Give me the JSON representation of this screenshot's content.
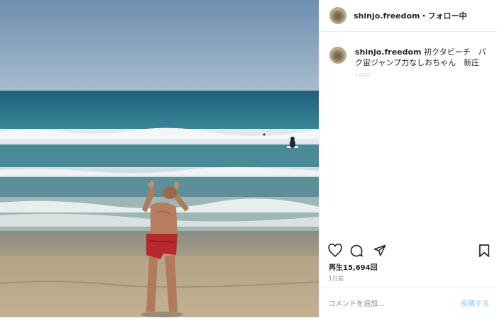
{
  "header": {
    "username": "shinjo.freedom",
    "separator": "・",
    "follow_label": "フォロー中"
  },
  "caption": {
    "username": "shinjo.freedom",
    "text": "初クタビーチ　バク宙ジャンプ力なしおちゃん　新庄"
  },
  "actions": {
    "like_icon": "heart-icon",
    "comment_icon": "comment-icon",
    "share_icon": "share-icon",
    "save_icon": "bookmark-icon"
  },
  "stats": {
    "views_label": "再生",
    "views_count": "15,694回"
  },
  "post_age": "1日前",
  "comment_box": {
    "placeholder": "コメントを追加...",
    "post_label": "投稿する"
  },
  "colors": {
    "post_button_disabled": "#b3dbff",
    "sky": "#7e9cb8",
    "sea": "#2f6f86",
    "sand": "#b9a98a"
  }
}
